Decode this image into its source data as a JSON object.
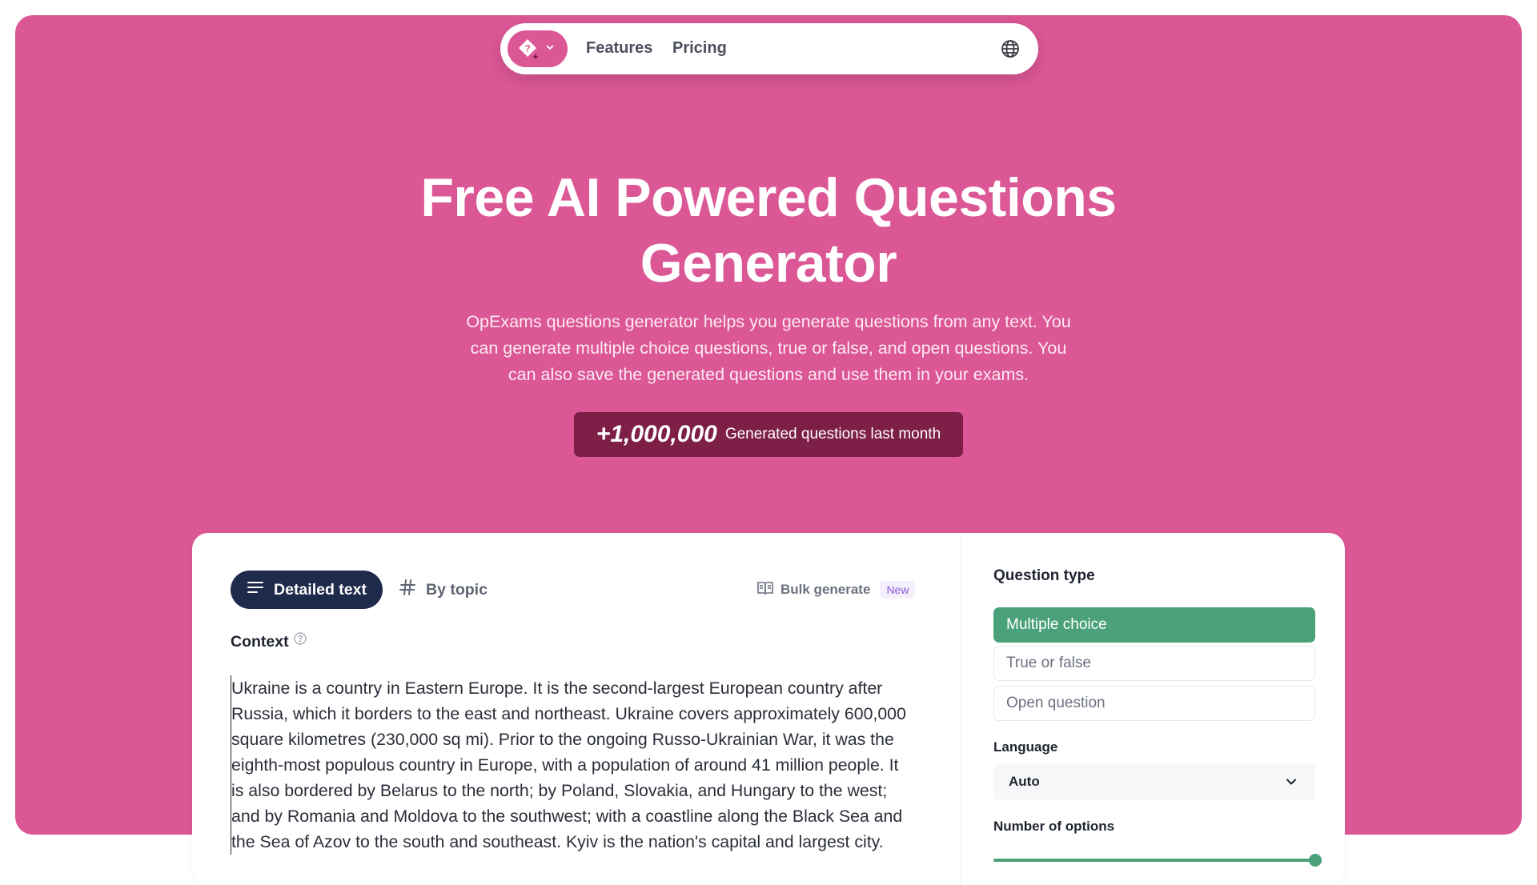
{
  "nav": {
    "features_label": "Features",
    "pricing_label": "Pricing"
  },
  "hero": {
    "title_line1": "Free AI Powered Questions",
    "title_line2": "Generator",
    "subtitle_line1": "OpExams questions generator helps you generate questions from any text. You",
    "subtitle_line2": "can generate multiple choice questions, true or false, and open questions. You",
    "subtitle_line3": "can also save the generated questions and use them in your exams.",
    "stat_number": "+1,000,000",
    "stat_label": "Generated questions last month"
  },
  "generator": {
    "tabs": {
      "detailed_text": "Detailed text",
      "by_topic": "By topic"
    },
    "bulk_label": "Bulk generate",
    "bulk_badge": "New",
    "context_label": "Context",
    "context_lines": [
      "Ukraine is a country in Eastern Europe. It is the second-largest European country after",
      "Russia, which it borders to the east and northeast. Ukraine covers approximately 600,000",
      "square kilometres (230,000 sq mi). Prior to the ongoing Russo-Ukrainian War, it was the",
      "eighth-most populous country in Europe, with a population of around 41 million people. It",
      "is also bordered by Belarus to the north; by Poland, Slovakia, and Hungary to the west;",
      "and by Romania and Moldova to the southwest; with a coastline along the Black Sea and",
      "the Sea of Azov to the south and southeast. Kyiv is the nation's capital and largest city."
    ]
  },
  "settings": {
    "question_type_label": "Question type",
    "question_types": [
      "Multiple choice",
      "True or false",
      "Open question"
    ],
    "selected_type": "Multiple choice",
    "language_label": "Language",
    "language_value": "Auto",
    "options_label": "Number of options",
    "options_slider_fraction": 1.0
  },
  "colors": {
    "brand_pink": "#db5795",
    "accent_green": "#4ba17a",
    "navy": "#1e2a4a",
    "badge_maroon": "#7e1f48"
  },
  "icons": {
    "logo": "sparkle-question-icon",
    "globe": "globe-icon",
    "detailed_text": "lines-icon",
    "by_topic": "hash-icon",
    "bulk": "book-icon",
    "help": "help-circle-icon",
    "dropdown": "chevron-down-icon"
  }
}
